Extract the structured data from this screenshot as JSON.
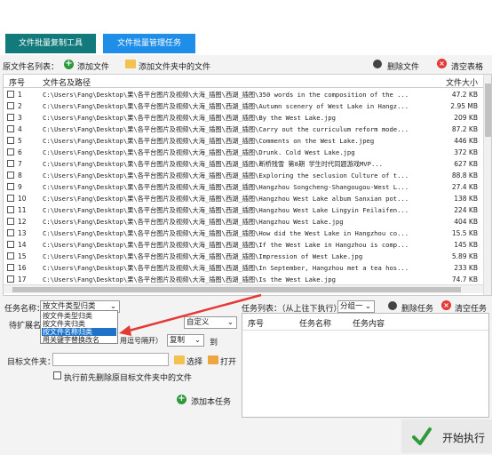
{
  "tabs": [
    "文件批量复制工具",
    "文件批量管理任务"
  ],
  "toolbar": {
    "list_label": "原文件名列表：",
    "add_file": "添加文件",
    "add_folder_files": "添加文件夹中的文件",
    "delete_file": "删除文件",
    "clear_table": "清空表格"
  },
  "table": {
    "col_no": "序号",
    "col_path": "文件名及路径",
    "col_size": "文件大小",
    "rows": [
      {
        "no": "1",
        "path": "C:\\Users\\Fang\\Desktop\\果\\各平台图片及视频\\大海_插图\\西湖_插图\\350 words in the composition of the ...",
        "size": "47.2 KB"
      },
      {
        "no": "2",
        "path": "C:\\Users\\Fang\\Desktop\\果\\各平台图片及视频\\大海_插图\\西湖_插图\\Autumn scenery of West Lake in Hangz...",
        "size": "2.95 MB"
      },
      {
        "no": "3",
        "path": "C:\\Users\\Fang\\Desktop\\果\\各平台图片及视频\\大海_插图\\西湖_插图\\By the West Lake.jpg",
        "size": "209 KB"
      },
      {
        "no": "4",
        "path": "C:\\Users\\Fang\\Desktop\\果\\各平台图片及视频\\大海_插图\\西湖_插图\\Carry out the curriculum reform mode...",
        "size": "87.2 KB"
      },
      {
        "no": "5",
        "path": "C:\\Users\\Fang\\Desktop\\果\\各平台图片及视频\\大海_插图\\西湖_插图\\Comments on the West Lake.jpeg",
        "size": "446 KB"
      },
      {
        "no": "6",
        "path": "C:\\Users\\Fang\\Desktop\\果\\各平台图片及视频\\大海_插图\\西湖_插图\\Drunk. Cold West Lake.jpg",
        "size": "372 KB"
      },
      {
        "no": "7",
        "path": "C:\\Users\\Fang\\Desktop\\果\\各平台图片及视频\\大海_插图\\西湖_插图\\断桥残雪 第8期 学生时代同题游戏MVP...",
        "size": "627 KB"
      },
      {
        "no": "8",
        "path": "C:\\Users\\Fang\\Desktop\\果\\各平台图片及视频\\大海_插图\\西湖_插图\\Exploring the seclusion Culture of t...",
        "size": "88.8 KB"
      },
      {
        "no": "9",
        "path": "C:\\Users\\Fang\\Desktop\\果\\各平台图片及视频\\大海_插图\\西湖_插图\\Hangzhou Songcheng-Shangougou-West L...",
        "size": "27.4 KB"
      },
      {
        "no": "10",
        "path": "C:\\Users\\Fang\\Desktop\\果\\各平台图片及视频\\大海_插图\\西湖_插图\\Hangzhou West Lake album Sanxian pot...",
        "size": "138 KB"
      },
      {
        "no": "11",
        "path": "C:\\Users\\Fang\\Desktop\\果\\各平台图片及视频\\大海_插图\\西湖_插图\\Hangzhou West Lake Lingyin Feilaifen...",
        "size": "224 KB"
      },
      {
        "no": "12",
        "path": "C:\\Users\\Fang\\Desktop\\果\\各平台图片及视频\\大海_插图\\西湖_插图\\Hangzhou West Lake.jpg",
        "size": "404 KB"
      },
      {
        "no": "13",
        "path": "C:\\Users\\Fang\\Desktop\\果\\各平台图片及视频\\大海_插图\\西湖_插图\\How did the West Lake in Hangzhou co...",
        "size": "15.5 KB"
      },
      {
        "no": "14",
        "path": "C:\\Users\\Fang\\Desktop\\果\\各平台图片及视频\\大海_插图\\西湖_插图\\If the West Lake in Hangzhou is comp...",
        "size": "145 KB"
      },
      {
        "no": "15",
        "path": "C:\\Users\\Fang\\Desktop\\果\\各平台图片及视频\\大海_插图\\西湖_插图\\Impression of West Lake.jpg",
        "size": "5.89 KB"
      },
      {
        "no": "16",
        "path": "C:\\Users\\Fang\\Desktop\\果\\各平台图片及视频\\大海_插图\\西湖_插图\\In September, Hangzhou met a tea hos...",
        "size": "233 KB"
      },
      {
        "no": "17",
        "path": "C:\\Users\\Fang\\Desktop\\果\\各平台图片及视频\\大海_插图\\西湖_插图\\Is the West Lake.jpg",
        "size": "74.7 KB"
      }
    ]
  },
  "task_form": {
    "task_name_label": "任务名称：",
    "task_name_value": "按文件类型归类",
    "task_options": [
      "按文件类型归类",
      "按文件夹归类",
      "按文件名称归类",
      "用关键字替换改名"
    ],
    "ext_label": "待扩展名",
    "custom_value": "自定义",
    "hint_partial": "用逗号隔开）",
    "copy_value": "复制",
    "to_label": "到",
    "target_folder_label": "目标文件夹：",
    "choose_btn": "选择",
    "open_btn": "打开",
    "delete_before_label": "执行前先删除原目标文件夹中的文件",
    "add_task_btn": "添加本任务"
  },
  "task_list": {
    "label": "任务列表：（从上往下执行）",
    "group_value": "分组一",
    "delete_task": "删除任务",
    "clear_task": "清空任务",
    "col_no": "序号",
    "col_name": "任务名称",
    "col_content": "任务内容"
  },
  "start_btn": "开始执行",
  "colors": {
    "tab_active": "#127a7a",
    "tab_blue": "#1e8ee8",
    "selection": "#1e73c8",
    "arrow": "#e53935",
    "start_check": "#2e9a3c"
  }
}
